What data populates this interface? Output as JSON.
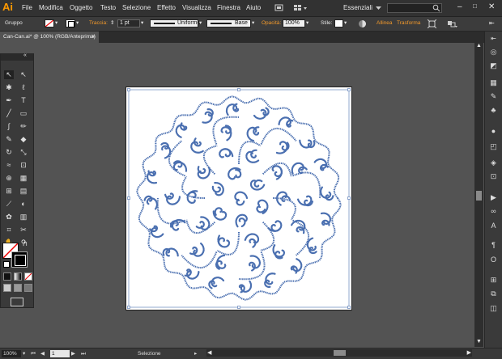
{
  "menu": {
    "logo": "Ai",
    "items": [
      "File",
      "Modifica",
      "Oggetto",
      "Testo",
      "Selezione",
      "Effetto",
      "Visualizza",
      "Finestra",
      "Aiuto"
    ],
    "workspace": "Essenziali"
  },
  "control": {
    "selection_type": "Gruppo",
    "stroke_label": "Traccia:",
    "stroke_weight": "1 pt",
    "profile": "Uniforme",
    "brush": "Base",
    "opacity_label": "Opacità:",
    "opacity_value": "100%",
    "style_label": "Stile:",
    "align_label": "Allinea",
    "transform_label": "Trasforma"
  },
  "document": {
    "tab_title": "Can-Can.ai* @ 100% (RGB/Anteprima)"
  },
  "status": {
    "zoom": "100%",
    "artboard_number": "1",
    "tool_info": "Selezione"
  },
  "colors": {
    "accent": "#ff9a00",
    "label_orange": "#f39a2b",
    "artwork_stroke": "#4a6fb0"
  },
  "icons": [
    "selection-icon",
    "direct-selection-icon",
    "magic-wand-icon",
    "lasso-icon",
    "pen-icon",
    "type-icon",
    "line-icon",
    "rectangle-icon",
    "brush-icon",
    "pencil-icon",
    "blob-brush-icon",
    "eraser-icon",
    "rotate-icon",
    "scale-icon",
    "warp-icon",
    "free-transform-icon",
    "shape-builder-icon",
    "perspective-icon",
    "mesh-icon",
    "gradient-icon",
    "eyedropper-icon",
    "blend-icon",
    "symbol-sprayer-icon",
    "graph-icon",
    "artboard-icon",
    "slice-icon",
    "hand-icon",
    "zoom-icon"
  ]
}
